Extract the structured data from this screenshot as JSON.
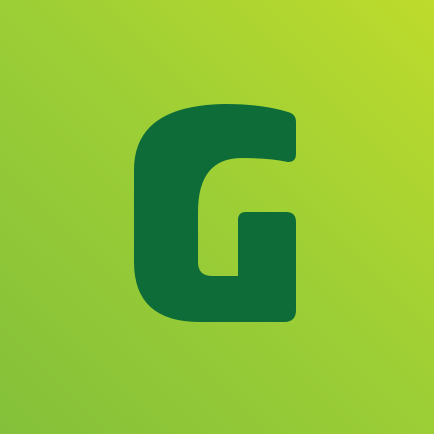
{
  "icon": {
    "logo": "g-letter-logo-icon",
    "logo_letter": "G",
    "colors": {
      "background_light": "#BEDB2C",
      "background_mid": "#9ECF35",
      "background_dark": "#84C03A",
      "logo": "#0E6C38"
    }
  }
}
